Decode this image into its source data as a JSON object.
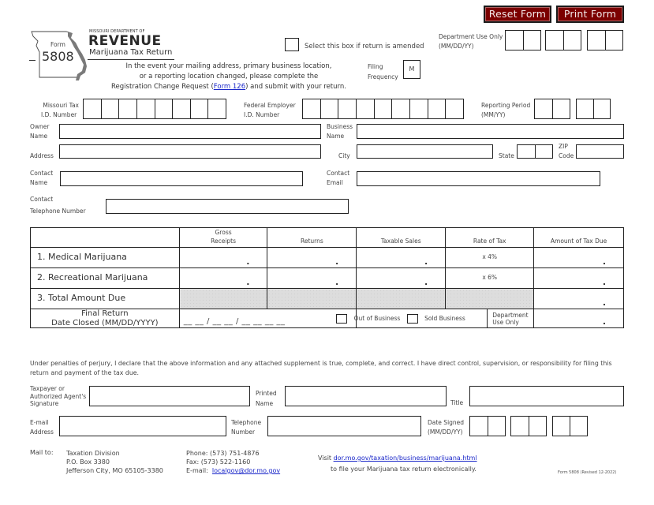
{
  "header": {
    "agency_small": "MISSOURI DEPARTMENT OF",
    "agency_big": "REVENUE",
    "form_label": "Form",
    "form_number": "5808",
    "form_title": "Marijuana Tax Return",
    "notice_line1": "In the event your mailing address, primary business location,",
    "notice_line2": "or a reporting location changed, please complete the",
    "notice_line3_pre": "Registration Change Request (",
    "notice_link": "Form 126",
    "notice_line3_post": ") and submit with your return.",
    "amended_label": "Select this box if return is amended",
    "dept_use_label": "Department Use Only",
    "dept_use_format": "(MM/DD/YY)",
    "filing_freq_label1": "Filing",
    "filing_freq_label2": "Frequency",
    "filing_freq_value": "M",
    "buttons": {
      "reset": "Reset Form",
      "print": "Print Form"
    }
  },
  "ids": {
    "mo_tax_label1": "Missouri Tax",
    "mo_tax_label2": "I.D. Number",
    "fein_label1": "Federal Employer",
    "fein_label2": "I.D. Number",
    "period_label1": "Reporting Period",
    "period_label2": "(MM/YY)"
  },
  "fields": {
    "owner_name1": "Owner",
    "owner_name2": "Name",
    "business_name1": "Business",
    "business_name2": "Name",
    "address": "Address",
    "city": "City",
    "state": "State",
    "zip1": "ZIP",
    "zip2": "Code",
    "contact_name1": "Contact",
    "contact_name2": "Name",
    "contact_email1": "Contact",
    "contact_email2": "Email",
    "contact_phone1": "Contact",
    "contact_phone2": "Telephone Number"
  },
  "table": {
    "headers": {
      "gross1": "Gross",
      "gross2": "Receipts",
      "returns": "Returns",
      "taxable": "Taxable Sales",
      "rate": "Rate of Tax",
      "amount": "Amount of Tax Due"
    },
    "rows": [
      {
        "label": "1. Medical Marijuana",
        "rate": "x  4%"
      },
      {
        "label": "2. Recreational Marijuana",
        "rate": "x  6%"
      },
      {
        "label": "3. Total Amount Due"
      }
    ],
    "decimal": ".",
    "final_return1": "Final Return",
    "final_return2": "Date Closed (MM/DD/YYYY)",
    "date_placeholder": "__ __ / __ __ / __ __ __ __",
    "out_of_business": "Out of Business",
    "sold_business": "Sold Business",
    "dept_use1": "Department",
    "dept_use2": "Use Only"
  },
  "declaration": {
    "text": "Under penalties of perjury, I declare that the above information and any attached supplement is true, complete, and correct.  I have direct control, supervision, or responsibility for filing this return and payment of the tax due.",
    "signature1": "Taxpayer or",
    "signature2": "Authorized Agent's",
    "signature3": "Signature",
    "printed1": "Printed",
    "printed2": "Name",
    "title": "Title",
    "email1": "E-mail",
    "email2": "Address",
    "phone1": "Telephone",
    "phone2": "Number",
    "date1": "Date Signed",
    "date2": "(MM/DD/YY)"
  },
  "footer": {
    "mail_to": "Mail to:",
    "addr1": "Taxation Division",
    "addr2": "P.O. Box 3380",
    "addr3": "Jefferson City, MO 65105-3380",
    "phone": "Phone: (573) 751-4876",
    "fax": "Fax: (573) 522-1160",
    "email_label": "E-mail:",
    "email_link": "localgov@dor.mo.gov",
    "visit": "Visit",
    "visit_link": "dor.mo.gov/taxation/business/marijuana.html",
    "visit_line2": "to file your Marijuana tax return electronically.",
    "revision": "Form 5808 (Revised 12-2022)"
  }
}
